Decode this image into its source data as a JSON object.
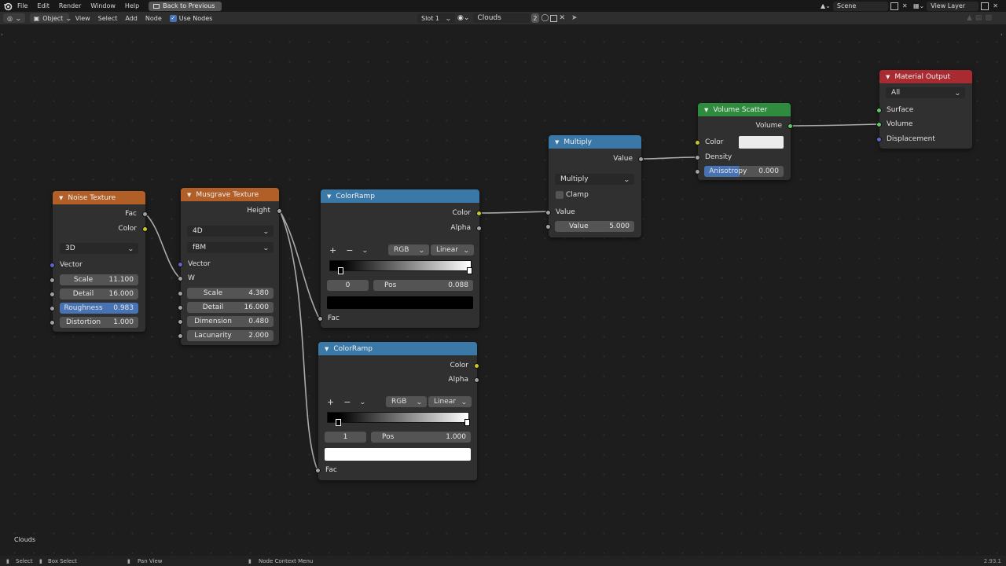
{
  "topbar": {
    "menus": [
      "File",
      "Edit",
      "Render",
      "Window",
      "Help"
    ],
    "back_label": "Back to Previous",
    "scene_label": "Scene",
    "view_layer_label": "View Layer"
  },
  "header": {
    "mode_label": "Object",
    "menus": [
      "View",
      "Select",
      "Add",
      "Node"
    ],
    "use_nodes_label": "Use Nodes",
    "slot_label": "Slot 1",
    "material_name": "Clouds",
    "user_count": "2"
  },
  "canvas": {
    "material_label": "Clouds"
  },
  "statusbar": {
    "select": "Select",
    "box_select": "Box Select",
    "pan_view": "Pan View",
    "context_menu": "Node Context Menu",
    "version": "2.93.1"
  },
  "nodes": {
    "noise": {
      "title": "Noise Texture",
      "out_fac": "Fac",
      "out_color": "Color",
      "dimension": "3D",
      "in_vector": "Vector",
      "scale_label": "Scale",
      "scale_value": "11.100",
      "detail_label": "Detail",
      "detail_value": "16.000",
      "roughness_label": "Roughness",
      "roughness_value": "0.983",
      "distortion_label": "Distortion",
      "distortion_value": "1.000"
    },
    "musgrave": {
      "title": "Musgrave Texture",
      "out_height": "Height",
      "dimension": "4D",
      "type": "fBM",
      "in_vector": "Vector",
      "in_w": "W",
      "scale_label": "Scale",
      "scale_value": "4.380",
      "detail_label": "Detail",
      "detail_value": "16.000",
      "dimension_label": "Dimension",
      "dimension_value": "0.480",
      "lacunarity_label": "Lacunarity",
      "lacunarity_value": "2.000"
    },
    "ramp1": {
      "title": "ColorRamp",
      "out_color": "Color",
      "out_alpha": "Alpha",
      "plus": "+",
      "minus": "−",
      "color_mode": "RGB",
      "interpolation": "Linear",
      "stop_index": "0",
      "pos_label": "Pos",
      "pos_value": "0.088",
      "swatch_color": "#000000",
      "in_fac": "Fac"
    },
    "ramp2": {
      "title": "ColorRamp",
      "out_color": "Color",
      "out_alpha": "Alpha",
      "plus": "+",
      "minus": "−",
      "color_mode": "RGB",
      "interpolation": "Linear",
      "stop_index": "1",
      "pos_label": "Pos",
      "pos_value": "1.000",
      "swatch_color": "#ffffff",
      "in_fac": "Fac"
    },
    "multiply": {
      "title": "Multiply",
      "out_value": "Value",
      "operation": "Multiply",
      "clamp_label": "Clamp",
      "in_value": "Value",
      "value_label": "Value",
      "value_value": "5.000"
    },
    "volume_scatter": {
      "title": "Volume Scatter",
      "out_volume": "Volume",
      "color_label": "Color",
      "color_swatch": "#ebebeb",
      "density_label": "Density",
      "anisotropy_label": "Anisotropy",
      "anisotropy_value": "0.000"
    },
    "material_output": {
      "title": "Material Output",
      "target": "All",
      "in_surface": "Surface",
      "in_volume": "Volume",
      "in_displacement": "Displacement"
    }
  },
  "colors": {
    "texture_header": "#b25f27",
    "converter_header": "#3a78a8",
    "shader_header": "#2f8b3d",
    "output_header": "#a82b32",
    "selected_field": "#4772b3"
  }
}
